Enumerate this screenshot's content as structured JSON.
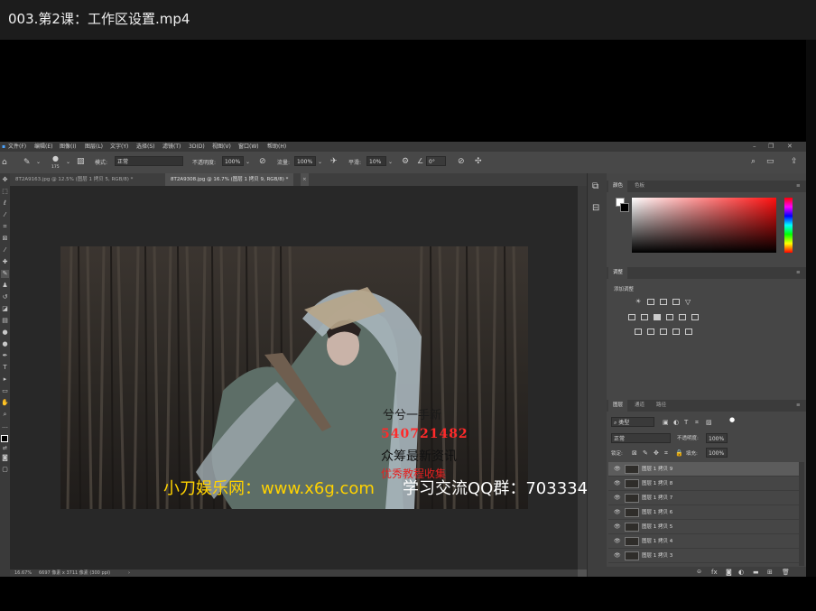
{
  "video": {
    "title": "003.第2课：工作区设置.mp4"
  },
  "menu": [
    "文件(F)",
    "编辑(E)",
    "图像(I)",
    "图层(L)",
    "文字(Y)",
    "选择(S)",
    "滤镜(T)",
    "3D(D)",
    "视图(V)",
    "窗口(W)",
    "帮助(H)"
  ],
  "options": {
    "brush_size": "175",
    "mode_label": "模式:",
    "mode_value": "正常",
    "opacity_label": "不透明度:",
    "opacity_value": "100%",
    "flow_label": "流量:",
    "flow_value": "100%",
    "smooth_label": "平滑:",
    "smooth_value": "10%",
    "angle_value": "0°"
  },
  "tabs": [
    {
      "label": "8T2A9163.jpg @ 12.5% (图层 1 拷贝 5, RGB/8) *"
    },
    {
      "label": "8T2A9308.jpg @ 16.7% (图层 1 拷贝 9, RGB/8) *"
    }
  ],
  "status": {
    "zoom": "16.67%",
    "doc_size": "6697 像素 x 3711 像素 (300 ppi)"
  },
  "color_panel": {
    "tabs": [
      "颜色",
      "色板"
    ]
  },
  "adjust_panel": {
    "tab": "调整",
    "add_label": "添加调整"
  },
  "layers_panel": {
    "tabs": [
      "图层",
      "通道",
      "路径"
    ],
    "filter_kind": "类型",
    "blend_mode": "正常",
    "opacity_label": "不透明度:",
    "opacity_value": "100%",
    "lock_label": "锁定:",
    "fill_label": "填充:",
    "fill_value": "100%",
    "layers": [
      "图层 1 拷贝 9",
      "图层 1 拷贝 8",
      "图层 1 拷贝 7",
      "图层 1 拷贝 6",
      "图层 1 拷贝 5",
      "图层 1 拷贝 4",
      "图层 1 拷贝 3"
    ]
  },
  "overlay": {
    "line1": "兮兮一手新",
    "phone": "540721482",
    "line3": "众筹最新资讯",
    "line4": "优秀教程收集",
    "watermark_yellow": "小刀娱乐网：www.x6g.com",
    "watermark_white": "学习交流QQ群：703334"
  },
  "colors": {
    "watermark": "#ffd200",
    "overlay_red": "#ff2a2a",
    "panel_bg": "#464646"
  }
}
